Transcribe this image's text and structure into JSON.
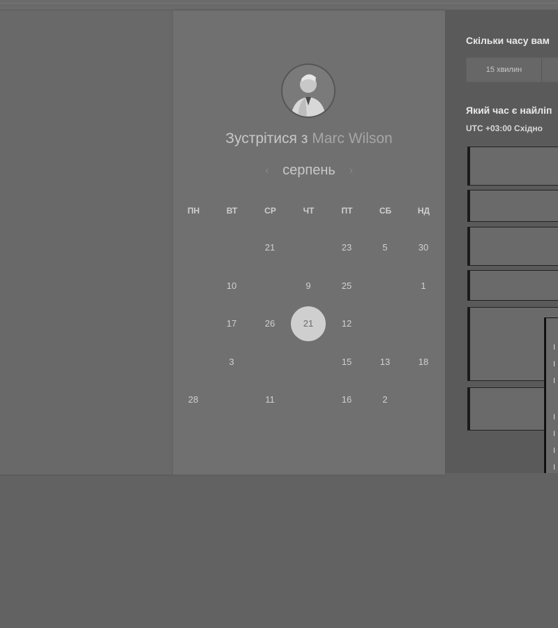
{
  "calendar": {
    "title_prefix": "Зустрітися з",
    "host_name": "Marc Wilson",
    "month": "серпень",
    "prev_icon": "chevron-left-icon",
    "next_icon": "chevron-right-icon",
    "weekdays": [
      "ПН",
      "ВТ",
      "СР",
      "ЧТ",
      "ПТ",
      "СБ",
      "НД"
    ],
    "weeks": [
      [
        {
          "d": "",
          "s": "muted"
        },
        {
          "d": "",
          "s": "muted"
        },
        {
          "d": "21",
          "s": "active"
        },
        {
          "d": "",
          "s": "muted"
        },
        {
          "d": "23",
          "s": "active"
        },
        {
          "d": "5",
          "s": "active"
        },
        {
          "d": "30",
          "s": "active"
        }
      ],
      [
        {
          "d": "",
          "s": "muted"
        },
        {
          "d": "10",
          "s": "active"
        },
        {
          "d": "",
          "s": "muted"
        },
        {
          "d": "9",
          "s": "active"
        },
        {
          "d": "25",
          "s": "active"
        },
        {
          "d": "",
          "s": "muted"
        },
        {
          "d": "1",
          "s": "active"
        }
      ],
      [
        {
          "d": "",
          "s": "muted"
        },
        {
          "d": "17",
          "s": "active"
        },
        {
          "d": "26",
          "s": "active"
        },
        {
          "d": "21",
          "s": "selected"
        },
        {
          "d": "12",
          "s": "active"
        },
        {
          "d": "",
          "s": "muted"
        },
        {
          "d": "",
          "s": "muted"
        }
      ],
      [
        {
          "d": "",
          "s": "muted"
        },
        {
          "d": "3",
          "s": "active"
        },
        {
          "d": "",
          "s": "muted"
        },
        {
          "d": "",
          "s": "muted"
        },
        {
          "d": "15",
          "s": "active"
        },
        {
          "d": "13",
          "s": "active"
        },
        {
          "d": "18",
          "s": "active"
        }
      ],
      [
        {
          "d": "28",
          "s": "active"
        },
        {
          "d": "",
          "s": "muted"
        },
        {
          "d": "11",
          "s": "active"
        },
        {
          "d": "",
          "s": "muted"
        },
        {
          "d": "16",
          "s": "active"
        },
        {
          "d": "2",
          "s": "active"
        },
        {
          "d": "",
          "s": "muted"
        }
      ]
    ]
  },
  "sidebar": {
    "duration_question": "Скільки часу вам",
    "duration_option": "15 хвилин",
    "time_question": "Який час є найліп",
    "timezone": "UTC +03:00 Східно"
  },
  "colors": {
    "selected_day": "#cfcfcf",
    "panel": "#707070",
    "right_panel": "#5a5a5a"
  }
}
